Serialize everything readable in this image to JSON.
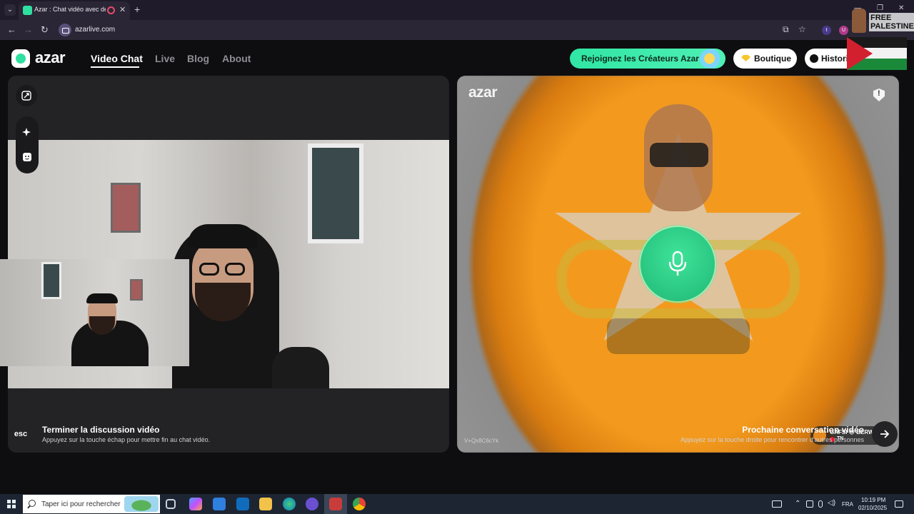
{
  "browser": {
    "tab_title": "Azar : Chat vidéo avec de n",
    "url": "azarlive.com",
    "new_tab_symbol": "+",
    "close_symbol": "✕",
    "window_controls": [
      "—",
      "❐",
      "✕"
    ],
    "extensions": [
      "t",
      "U"
    ]
  },
  "site": {
    "logo_text": "azar",
    "nav": [
      "Video Chat",
      "Live",
      "Blog",
      "About"
    ],
    "active_nav": "Video Chat",
    "creators_button": "Rejoignez les Créateurs Azar",
    "shop_button": "Boutique",
    "history_button": "Historiq",
    "accent_color": "#30e6a5"
  },
  "overlay": {
    "free_palestine_line1": "FREE",
    "free_palestine_line2": "PALESTINE"
  },
  "remote": {
    "watermark": "azar",
    "peer_id": "V+Qx8C6cYk",
    "peer_name": "GAFSI 😎 BERWILEE",
    "peer_country": "TN",
    "mic_state": "speaking"
  },
  "actions": {
    "esc_label": "esc",
    "end_title": "Terminer la discussion vidéo",
    "end_sub": "Appuyez sur la touche échap pour mettre fin au chat vidéo.",
    "next_title": "Prochaine conversation vidéo",
    "next_sub": "Appuyez sur la touche droite pour rencontrer d'autres personnes"
  },
  "taskbar": {
    "search_placeholder": "Taper ici pour rechercher",
    "language": "FRA",
    "time": "10:19 PM",
    "date": "02/10/2025"
  }
}
